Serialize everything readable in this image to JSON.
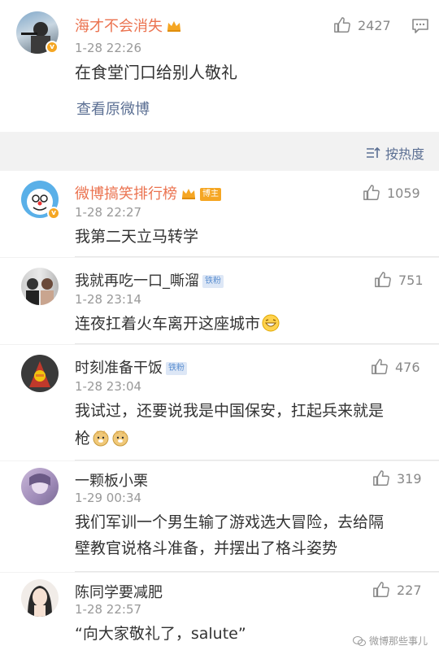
{
  "post": {
    "author": "海才不会消失",
    "time": "1-28 22:26",
    "text": "在食堂门口给别人敬礼",
    "view_original": "查看原微博",
    "likes": "2427"
  },
  "sort": {
    "label": "按热度"
  },
  "comments": [
    {
      "name": "微博搞笑排行榜",
      "tag": "博主",
      "time": "1-28 22:27",
      "text": "我第二天立马转学",
      "likes": "1059"
    },
    {
      "name": "我就再吃一口_嘶溜",
      "tag": "铁粉",
      "time": "1-28 23:14",
      "text": "连夜扛着火车离开这座城市",
      "likes": "751"
    },
    {
      "name": "时刻准备干饭",
      "tag": "铁粉",
      "time": "1-28 23:04",
      "text_line1": "我试过，还要说我是中国保安，扛起兵来就是",
      "text_line2": "枪",
      "likes": "476"
    },
    {
      "name": "一颗板小栗",
      "time": "1-29 00:34",
      "text_line1": "我们军训一个男生输了游戏选大冒险，去给隔",
      "text_line2": "壁教官说格斗准备，并摆出了格斗姿势",
      "likes": "319"
    },
    {
      "name": "陈同学要减肥",
      "time": "1-28 22:57",
      "text": "“向大家敬礼了，salute”",
      "likes": "227"
    }
  ],
  "watermark": "微博那些事儿",
  "colors": {
    "link": "#5b6f93",
    "name_highlight": "#eb7350",
    "badge": "#f5a623"
  }
}
